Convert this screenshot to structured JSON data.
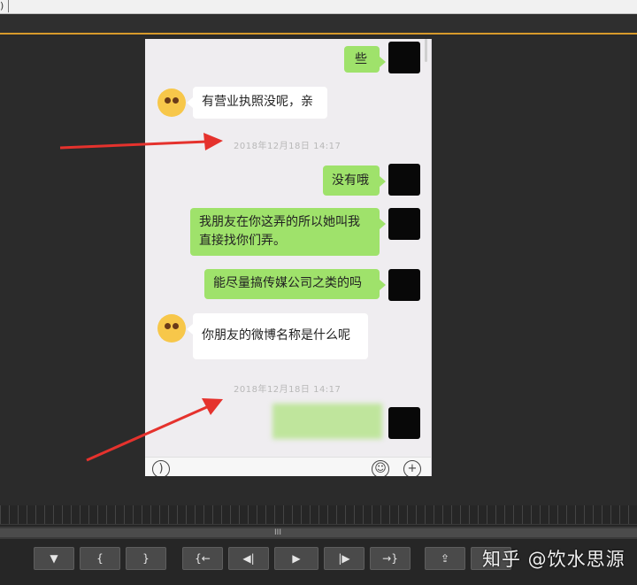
{
  "window": {
    "top_tab_label": ")"
  },
  "chat": {
    "messages": [
      {
        "id": "m1",
        "side": "right",
        "text": "些"
      },
      {
        "id": "m2",
        "side": "left",
        "text": "有营业执照没呢，亲"
      },
      {
        "id": "m3",
        "side": "right",
        "text": "没有哦"
      },
      {
        "id": "m4",
        "side": "right",
        "line1": "我朋友在你这弄的所以她叫我",
        "line2": "直接找你们弄。"
      },
      {
        "id": "m5",
        "side": "right",
        "text": "能尽量搞传媒公司之类的吗"
      },
      {
        "id": "m6",
        "side": "left",
        "text": "你朋友的微博名称是什么呢"
      }
    ],
    "timestamps": [
      "2018年12月18日 14:17",
      "2018年12月18日 14:17"
    ],
    "input_bar": {
      "voice_icon": "voice-icon",
      "emoji_icon": "emoji-icon",
      "add_icon": "add-icon"
    }
  },
  "colors": {
    "accent": "#d79a2b",
    "bubble_green": "#9fe26b",
    "arrow_red": "#e5322d"
  },
  "controls": {
    "buttons": [
      {
        "name": "add-marker-button",
        "glyph": "▼"
      },
      {
        "name": "mark-in-button",
        "glyph": "{"
      },
      {
        "name": "mark-out-button",
        "glyph": "}"
      },
      {
        "name": "go-to-in-button",
        "glyph": "{←"
      },
      {
        "name": "step-back-button",
        "glyph": "◀|"
      },
      {
        "name": "play-button",
        "glyph": "▶"
      },
      {
        "name": "step-forward-button",
        "glyph": "|▶"
      },
      {
        "name": "go-to-out-button",
        "glyph": "→}"
      },
      {
        "name": "lift-button",
        "glyph": "⇪"
      },
      {
        "name": "extract-button",
        "glyph": "⇫"
      }
    ],
    "scroll_grip": "III"
  },
  "watermark": "知乎 @饮水思源"
}
